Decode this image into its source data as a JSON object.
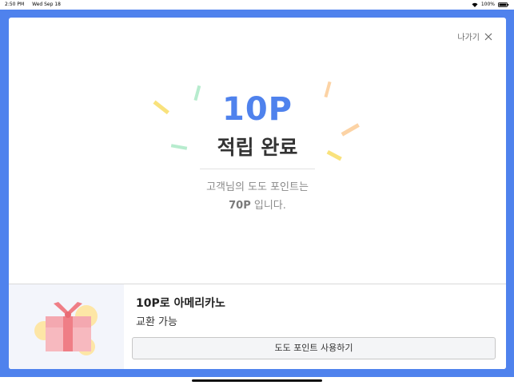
{
  "status_bar": {
    "time": "2:50 PM",
    "date": "Wed Sep 18",
    "battery": "100%",
    "icons": [
      "wifi-icon",
      "battery-icon"
    ]
  },
  "colors": {
    "accent": "#4f82ed",
    "title_text": "#333333",
    "muted_text": "#8a8a8a",
    "gift_box": "#f7b9bf",
    "gift_ribbon": "#ef7e86",
    "gift_bg_circle": "#fde6a6"
  },
  "header": {
    "exit_label": "나가기",
    "exit_icon": "close-icon"
  },
  "result": {
    "points": "10P",
    "title": "적립 완료",
    "message_line1": "고객님의 도도 포인트는",
    "message_points": "70P",
    "message_suffix": " 입니다."
  },
  "reward": {
    "icon": "gift-icon",
    "title": "10P로 아메리카노",
    "subtitle": "교환 가능",
    "button_label": "도도 포인트 사용하기"
  }
}
